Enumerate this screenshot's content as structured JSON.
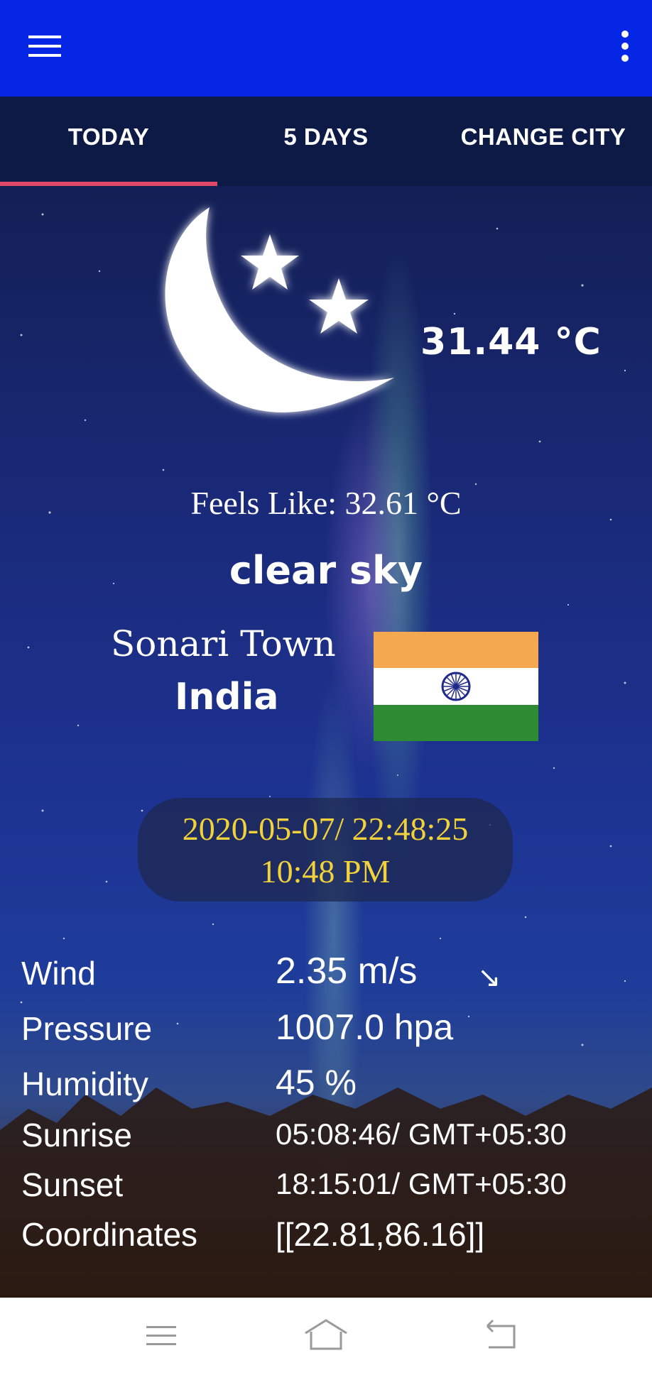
{
  "appbar": {
    "menu_icon": "hamburger-menu-icon",
    "more_icon": "more-vert-icon"
  },
  "tabs": [
    {
      "label": "TODAY",
      "active": true
    },
    {
      "label": "5 DAYS",
      "active": false
    },
    {
      "label": "CHANGE CITY",
      "active": false
    }
  ],
  "weather": {
    "icon": "moon-stars-icon",
    "temperature": "31.44 °C",
    "feels_like": "Feels Like: 32.61 °C",
    "description": "clear sky",
    "city": "Sonari Town",
    "country": "India",
    "flag": "india-flag-icon",
    "datetime": "2020-05-07/ 22:48:25",
    "time12": "10:48 PM"
  },
  "details": {
    "wind": {
      "label": "Wind",
      "value": "2.35 m/s",
      "arrow": "↘"
    },
    "pressure": {
      "label": "Pressure",
      "value": "1007.0 hpa"
    },
    "humidity": {
      "label": "Humidity",
      "value": "45 %"
    },
    "sunrise": {
      "label": "Sunrise",
      "value": "05:08:46/ GMT+05:30"
    },
    "sunset": {
      "label": "Sunset",
      "value": "18:15:01/ GMT+05:30"
    },
    "coordinates": {
      "label": "Coordinates",
      "value": "[[22.81,86.16]]"
    }
  },
  "colors": {
    "appbar": "#0626e6",
    "tabs_bg": "#0c1a45",
    "tab_indicator": "#e0486a",
    "date_text": "#f2d23a",
    "flag_saffron": "#f4a950",
    "flag_white": "#ffffff",
    "flag_green": "#2e8b34",
    "chakra": "#1f2a8a"
  }
}
